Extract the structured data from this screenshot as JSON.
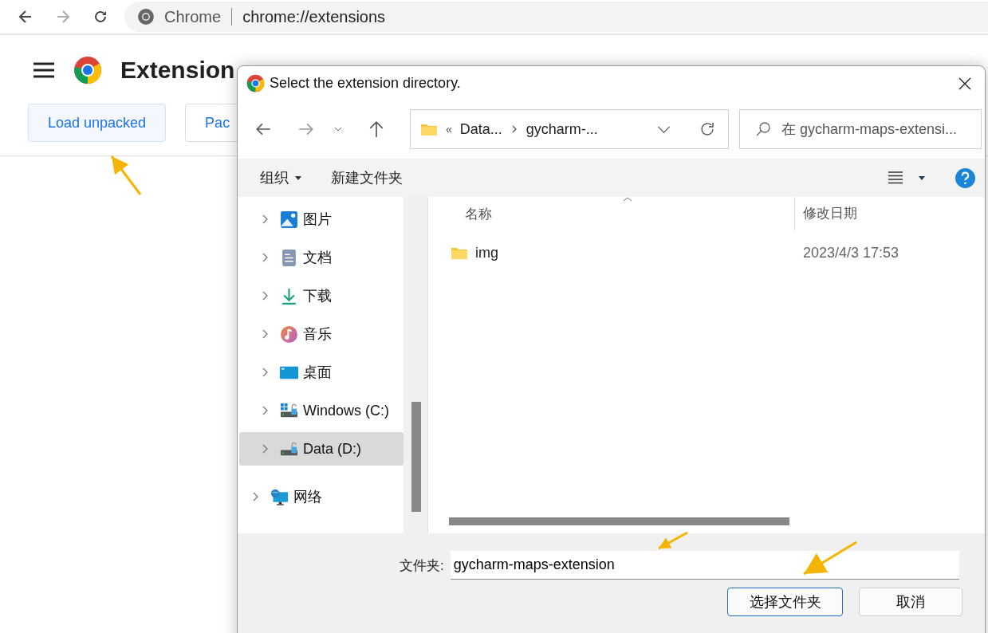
{
  "browser": {
    "site": "Chrome",
    "url": "chrome://extensions"
  },
  "page": {
    "title": "Extension",
    "buttons": [
      {
        "label": "Load unpacked",
        "kind": "primary"
      },
      {
        "label": "Pac",
        "kind": "plain"
      }
    ]
  },
  "dialog": {
    "title": "Select the extension directory.",
    "overflow": "«",
    "breadcrumb": [
      "Data...",
      "gycharm-..."
    ],
    "search": {
      "placeholder": "在 gycharm-maps-extensi..."
    },
    "toolbar": {
      "organize": "组织",
      "new_folder": "新建文件夹"
    },
    "tree": [
      {
        "children": [
          {
            "label": "图片",
            "kind": "pictures",
            "expanded": false,
            "selected": false
          },
          {
            "label": "文档",
            "kind": "documents",
            "expanded": false,
            "selected": false
          },
          {
            "label": "下载",
            "kind": "downloads",
            "expanded": false,
            "selected": false
          },
          {
            "label": "音乐",
            "kind": "music",
            "expanded": false,
            "selected": false
          },
          {
            "label": "桌面",
            "kind": "desktop",
            "expanded": false,
            "selected": false
          },
          {
            "label": "Windows (C:)",
            "kind": "system-drive",
            "expanded": false,
            "selected": false
          },
          {
            "label": "Data (D:)",
            "kind": "drive",
            "expanded": false,
            "selected": true
          }
        ]
      },
      {
        "label": "网络",
        "kind": "network",
        "expanded": false,
        "selected": false
      }
    ],
    "columns": [
      "名称",
      "修改日期"
    ],
    "files": [
      {
        "name": "img",
        "modified": "2023/4/3 17:53"
      }
    ],
    "folder_label": "文件夹:",
    "folder_value": "gycharm-maps-extension",
    "buttons": [
      {
        "label": "选择文件夹",
        "default": true
      },
      {
        "label": "取消",
        "default": false
      }
    ]
  }
}
